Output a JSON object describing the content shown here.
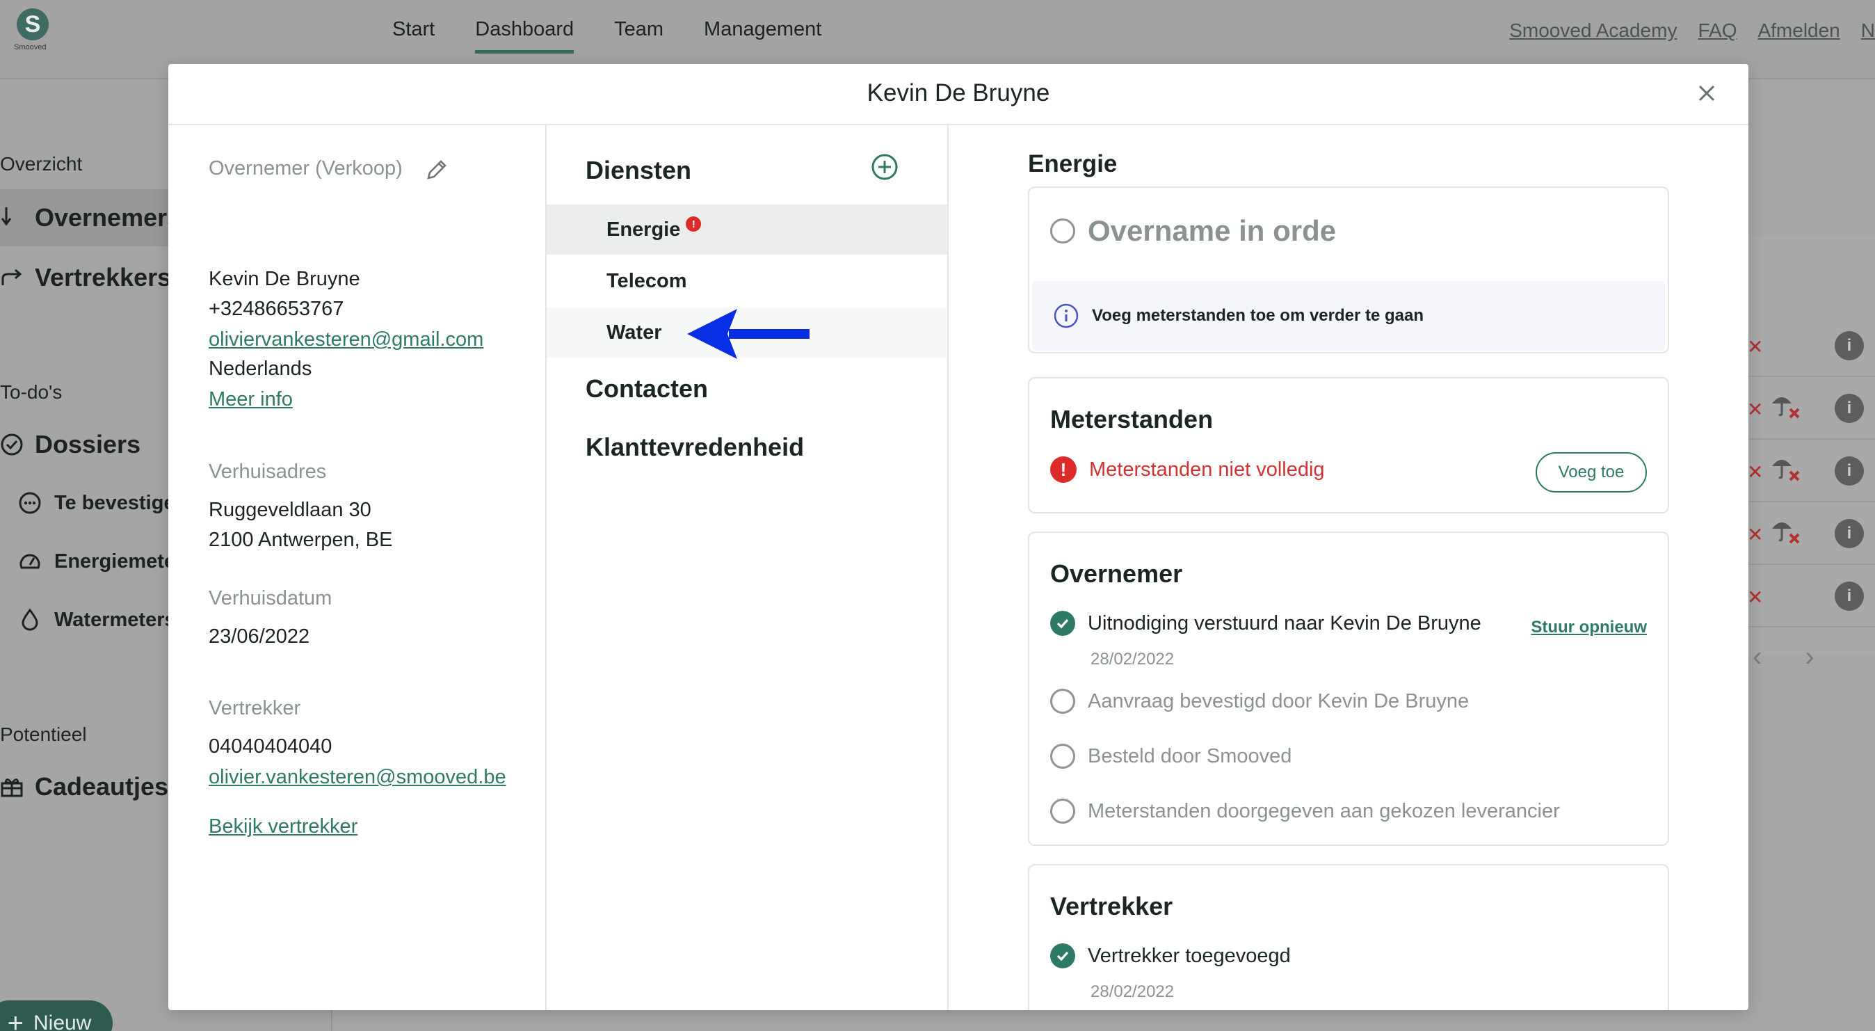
{
  "app": {
    "logo_text": "Smooved",
    "logo_letter": "S",
    "nav": [
      {
        "label": "Start"
      },
      {
        "label": "Dashboard",
        "active": true
      },
      {
        "label": "Team"
      },
      {
        "label": "Management"
      }
    ],
    "top_links": [
      "Smooved Academy",
      "FAQ",
      "Afmelden",
      "N"
    ]
  },
  "sidebar": {
    "overview_heading": "Overzicht",
    "overnemers": "Overnemers",
    "vertrekkers": "Vertrekkers",
    "todo_heading": "To-do's",
    "dossiers": "Dossiers",
    "te_bevestigen": "Te bevestigen",
    "energiemeters": "Energiemeters",
    "watermeters": "Watermeters",
    "potentieel_heading": "Potentieel",
    "cadeautjes": "Cadeautjes",
    "new_button": "Nieuw"
  },
  "background": {
    "pager_prev": "‹",
    "pager_next": "›",
    "info_symbol": "i",
    "x_symbol": "✕"
  },
  "modal": {
    "title": "Kevin De Bruyne",
    "left": {
      "role_label": "Overnemer (Verkoop)",
      "name": "Kevin De Bruyne",
      "phone": "+32486653767",
      "email": "oliviervankesteren@gmail.com",
      "language": "Nederlands",
      "more_info": "Meer info",
      "address_label": "Verhuisadres",
      "address_line1": "Ruggeveldlaan 30",
      "address_line2": "2100 Antwerpen, BE",
      "date_label": "Verhuisdatum",
      "date": "23/06/2022",
      "leaver_label": "Vertrekker",
      "leaver_phone": "04040404040",
      "leaver_email": "olivier.vankesteren@smooved.be",
      "view_leaver": "Bekijk vertrekker"
    },
    "middle": {
      "services_heading": "Diensten",
      "services": [
        {
          "label": "Energie",
          "error": true,
          "selected": true
        },
        {
          "label": "Telecom"
        },
        {
          "label": "Water"
        }
      ],
      "contacts_heading": "Contacten",
      "satisfaction_heading": "Klanttevredenheid"
    },
    "right": {
      "section_title": "Energie",
      "status_title": "Overname in orde",
      "info_text": "Voeg meterstanden toe om verder te gaan",
      "meters_title": "Meterstanden",
      "meters_error": "Meterstanden niet volledig",
      "meters_add_button": "Voeg toe",
      "taker_title": "Overnemer",
      "taker_steps": [
        {
          "label": "Uitnodiging verstuurd naar Kevin De Bruyne",
          "done": true,
          "date": "28/02/2022",
          "action": "Stuur opnieuw"
        },
        {
          "label": "Aanvraag bevestigd door Kevin De Bruyne",
          "done": false
        },
        {
          "label": "Besteld door Smooved",
          "done": false
        },
        {
          "label": "Meterstanden doorgegeven aan gekozen leverancier",
          "done": false
        }
      ],
      "leaver_title": "Vertrekker",
      "leaver_steps": [
        {
          "label": "Vertrekker toegevoegd",
          "done": true,
          "date": "28/02/2022"
        }
      ]
    }
  },
  "colors": {
    "brand_green": "#2f7a66",
    "error_red": "#dd2b2b",
    "annotation_arrow": "#0a2ee6",
    "info_blue": "#4a55c9"
  }
}
